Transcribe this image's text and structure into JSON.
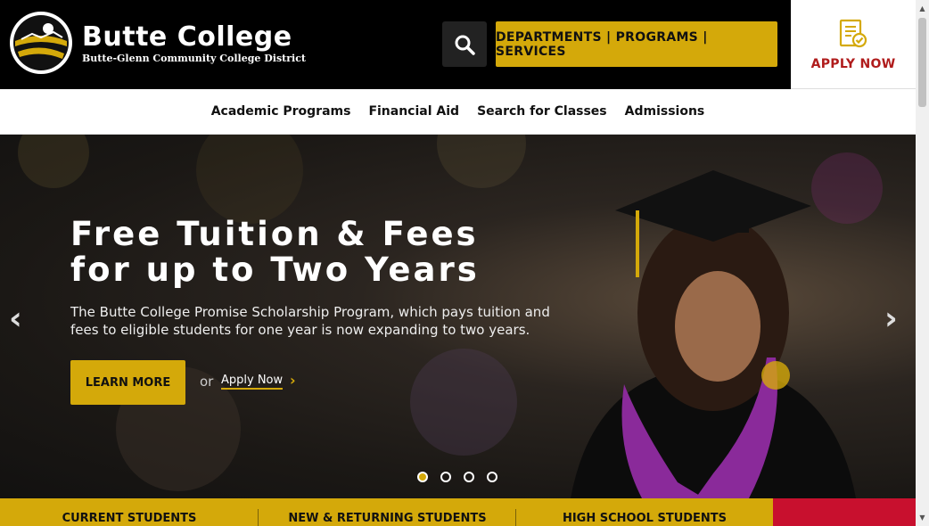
{
  "header": {
    "brand_name": "Butte College",
    "brand_sub": "Butte-Glenn Community College District",
    "dept_button": "DEPARTMENTS | PROGRAMS | SERVICES",
    "apply_label": "APPLY NOW"
  },
  "nav": {
    "items": [
      "Academic Programs",
      "Financial Aid",
      "Search for Classes",
      "Admissions"
    ]
  },
  "hero": {
    "title_line1": "Free Tuition & Fees",
    "title_line2": "for up to Two Years",
    "text": "The Butte College Promise Scholarship Program, which pays tuition and fees to eligible students for one year is now expanding to two years.",
    "learn_more": "LEARN MORE",
    "or": "or",
    "apply_link": "Apply Now",
    "slide_count": 4,
    "active_slide": 1
  },
  "bottom_tabs": [
    "CURRENT STUDENTS",
    "NEW & RETURNING STUDENTS",
    "HIGH SCHOOL STUDENTS"
  ],
  "colors": {
    "gold": "#d4a90a",
    "red": "#b01c1c",
    "black": "#000000"
  },
  "icons": [
    "search-icon",
    "apply-form-icon",
    "chevron-left-icon",
    "chevron-right-icon"
  ]
}
